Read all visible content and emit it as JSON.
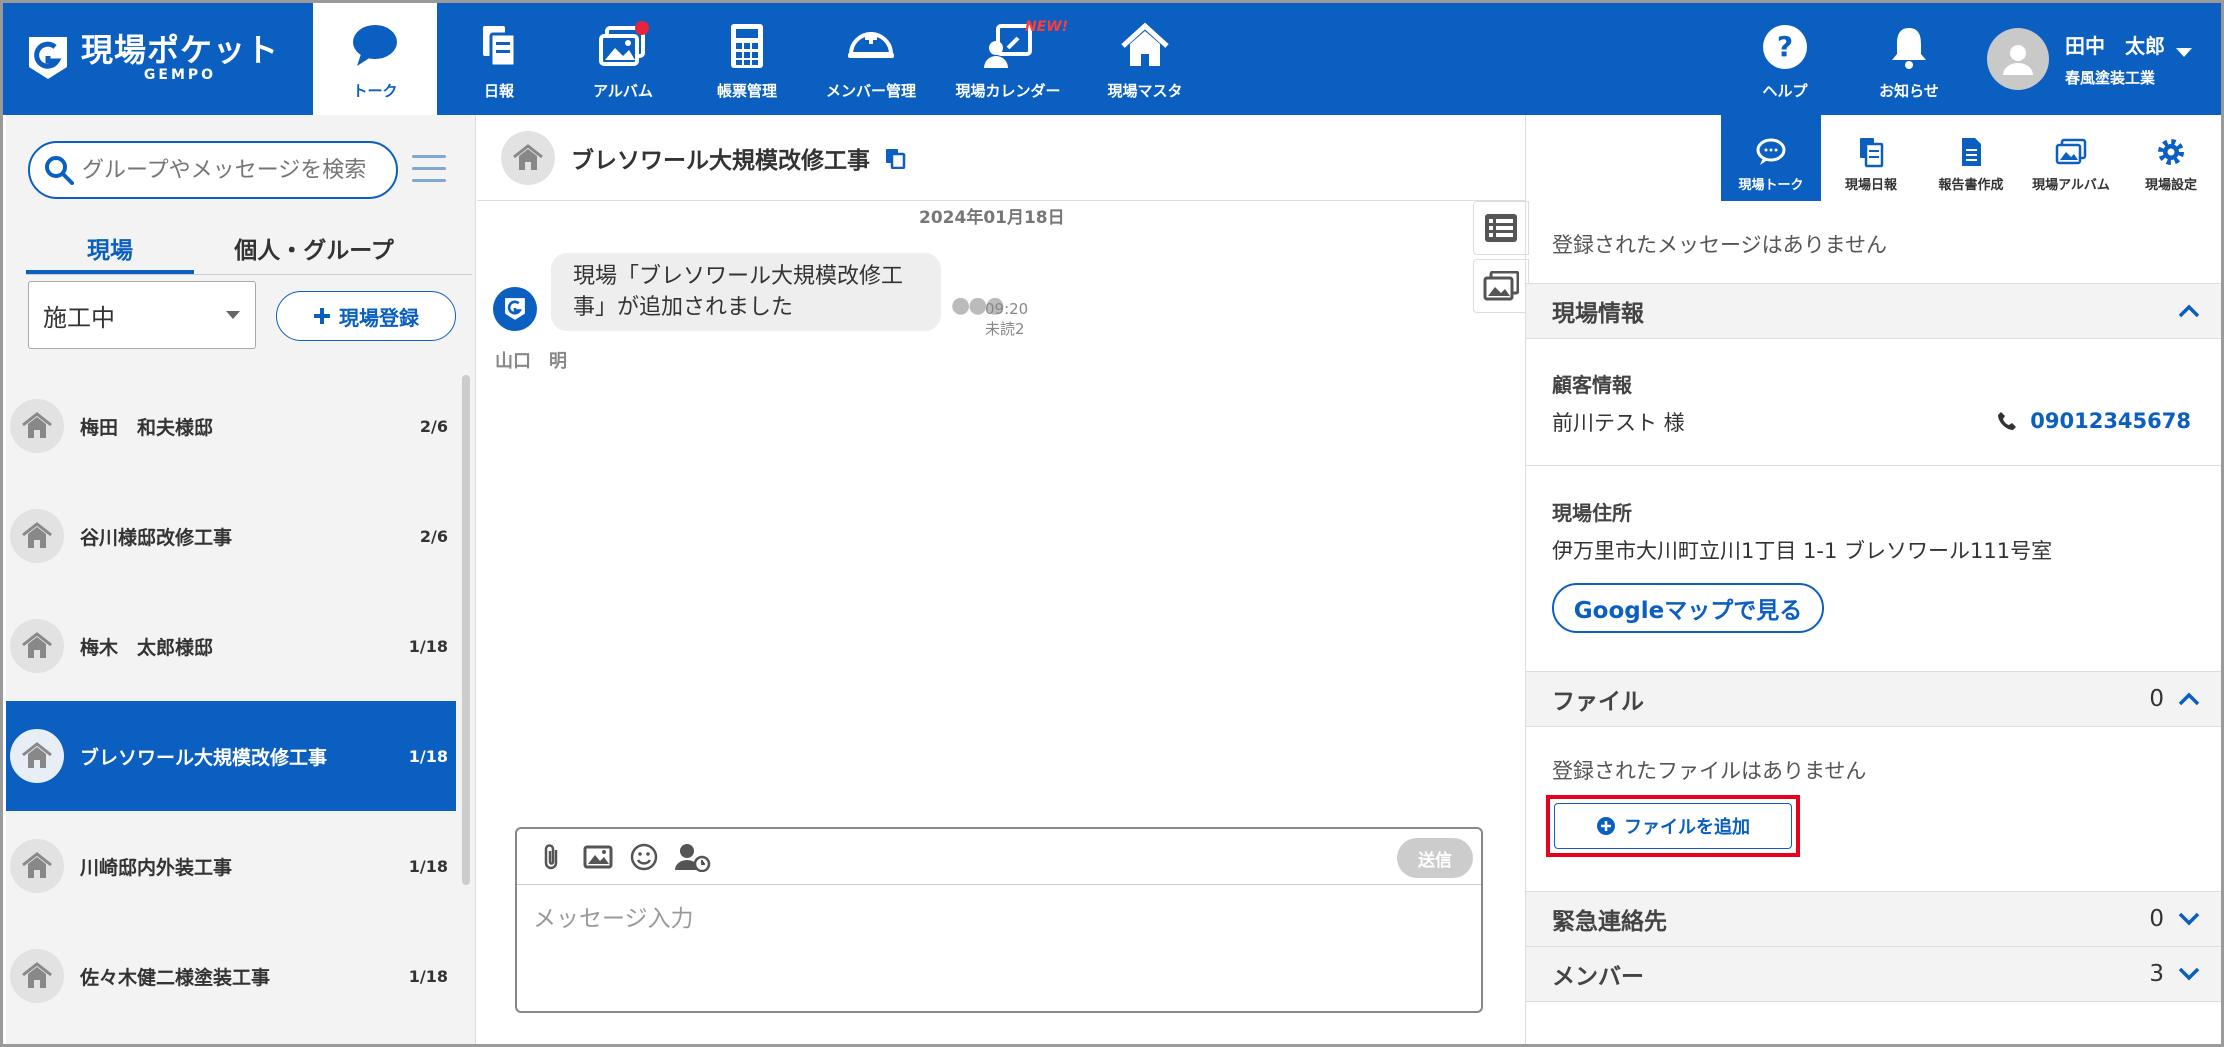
{
  "app": {
    "logo_main": "現場ポケット",
    "logo_sub": "GEMPO"
  },
  "nav": [
    {
      "label": "トーク",
      "icon": "chat-icon",
      "active": true
    },
    {
      "label": "日報",
      "icon": "report-icon"
    },
    {
      "label": "アルバム",
      "icon": "album-icon",
      "badge": "dot"
    },
    {
      "label": "帳票管理",
      "icon": "calculator-icon"
    },
    {
      "label": "メンバー管理",
      "icon": "helmet-icon"
    },
    {
      "label": "現場カレンダー",
      "icon": "calendar-icon",
      "badge_text": "NEW!"
    },
    {
      "label": "現場マスタ",
      "icon": "house-icon"
    }
  ],
  "top_right": {
    "help": "ヘルプ",
    "notice": "お知らせ",
    "user_name": "田中　太郎",
    "user_company": "春風塗装工業"
  },
  "sidebar": {
    "search_placeholder": "グループやメッセージを検索",
    "tabs": [
      "現場",
      "個人・グループ"
    ],
    "filter_selected": "施工中",
    "register_button": "現場登録",
    "items": [
      {
        "name": "梅田　和夫様邸",
        "count": "2/6"
      },
      {
        "name": "谷川様邸改修工事",
        "count": "2/6"
      },
      {
        "name": "梅木　太郎様邸",
        "count": "1/18"
      },
      {
        "name": "ブレソワール大規模改修工事",
        "count": "1/18",
        "active": true
      },
      {
        "name": "川崎邸内外装工事",
        "count": "1/18"
      },
      {
        "name": "佐々木健二様塗装工事",
        "count": "1/18"
      }
    ]
  },
  "chat": {
    "title": "ブレソワール大規模改修工事",
    "date": "2024年01月18日",
    "message_text": "現場「ブレソワール大規模改修工事」が追加されました",
    "message_time": "09:20",
    "message_unread": "未読2",
    "message_sender": "山口　明",
    "send_button": "送信",
    "input_placeholder": "メッセージ入力"
  },
  "right_panel": {
    "tabs": [
      "現場トーク",
      "現場日報",
      "報告書作成",
      "現場アルバム",
      "現場設定"
    ],
    "no_messages": "登録されたメッセージはありません",
    "site_info_title": "現場情報",
    "customer_label": "顧客情報",
    "customer_name": "前川テスト 様",
    "customer_phone": "09012345678",
    "address_label": "現場住所",
    "address": "伊万里市大川町立川1丁目 1-1 ブレソワール111号室",
    "map_button": "Googleマップで見る",
    "file_title": "ファイル",
    "file_count": "0",
    "no_files": "登録されたファイルはありません",
    "add_file_button": "ファイルを追加",
    "emergency_title": "緊急連絡先",
    "emergency_count": "0",
    "member_title": "メンバー",
    "member_count": "3"
  },
  "colors": {
    "brand": "#0a5fc0",
    "highlight": "#e8001c"
  }
}
